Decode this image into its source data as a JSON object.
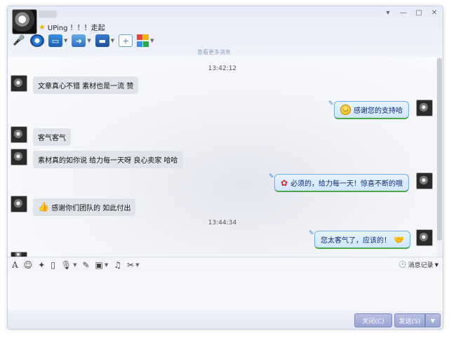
{
  "header": {
    "status_text": "UPing ！！！走起",
    "window_controls": [
      "▾",
      "—",
      "□",
      "✕"
    ],
    "sub_hint": "查看更多消息"
  },
  "chat": {
    "timestamps": [
      "13:42:12",
      "13:44:34"
    ],
    "messages": [
      {
        "dir": "in",
        "text": "文章真心不错 素材也是一流 赞"
      },
      {
        "dir": "out",
        "text": "感谢您的支持哈",
        "emoji": "smile-emoji"
      },
      {
        "dir": "in",
        "text": "客气客气"
      },
      {
        "dir": "in",
        "text": "素材真的如你说 给力每一天呀 良心卖家 哈哈"
      },
      {
        "dir": "out",
        "text": "必须的，给力每一天！惊喜不断的哦",
        "emoji": "rose-emoji"
      },
      {
        "dir": "in",
        "text": "感谢你们团队的 如此付出",
        "emoji": "thumbs-up-emoji"
      },
      {
        "dir": "out",
        "text": "您太客气了，应该的！",
        "emoji": "handshake-emoji"
      }
    ]
  },
  "input_toolbar": {
    "history_label": "消息记录"
  },
  "buttons": {
    "close_label": "关闭(C)",
    "send_label": "发送(S)",
    "send_arrow": "▼"
  },
  "colors": {
    "out_bubble_border": "#6fb0ef",
    "out_bubble_bottom": "#4aa84a",
    "button": "#97a3d2"
  }
}
